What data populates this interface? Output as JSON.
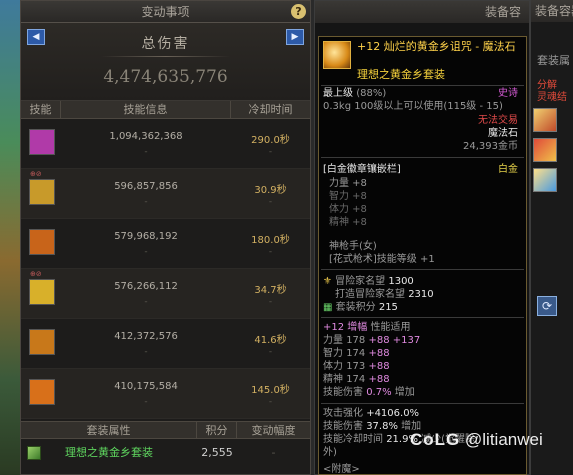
{
  "left_panel": {
    "title": "变动事项",
    "help": "?",
    "total_label": "总伤害",
    "total_value": "4,474,635,776",
    "columns": {
      "skill": "技能",
      "info": "技能信息",
      "cooldown": "冷却时间"
    },
    "skills": [
      {
        "damage": "1,094,362,368",
        "cooldown": "290.0秒",
        "delta": "-",
        "cd_delta": "-",
        "badges": "",
        "icon_color": "#b03aa8"
      },
      {
        "damage": "596,857,856",
        "cooldown": "30.9秒",
        "delta": "-",
        "cd_delta": "-",
        "badges": "⊕⊘",
        "icon_color": "#c89a2a"
      },
      {
        "damage": "579,968,192",
        "cooldown": "180.0秒",
        "delta": "-",
        "cd_delta": "-",
        "badges": "",
        "icon_color": "#c8641a"
      },
      {
        "damage": "576,266,112",
        "cooldown": "34.7秒",
        "delta": "-",
        "cd_delta": "-",
        "badges": "⊕⊘",
        "icon_color": "#d8b02a"
      },
      {
        "damage": "412,372,576",
        "cooldown": "41.6秒",
        "delta": "-",
        "cd_delta": "-",
        "badges": "",
        "icon_color": "#c8781a"
      },
      {
        "damage": "410,175,584",
        "cooldown": "145.0秒",
        "delta": "-",
        "cd_delta": "-",
        "badges": "",
        "icon_color": "#d8701a"
      }
    ],
    "set_columns": {
      "name": "套装属性",
      "score": "积分",
      "change": "变动幅度"
    },
    "set_row": {
      "name": "理想之黄金乡套装",
      "score": "2,555",
      "change": "-"
    }
  },
  "mid_panel": {
    "title": "装备容"
  },
  "tooltip": {
    "name": "+12 灿烂的黄金乡诅咒 - 魔法石",
    "set_name": "理想之黄金乡套装",
    "level_label": "最上级",
    "level_pct": "(88%)",
    "rarity": "史诗",
    "weight": "0.3kg",
    "level_req": "100级以上可以使用(115级 - 15)",
    "untradeable": "无法交易",
    "type": "魔法石",
    "price": "24,393金币",
    "socket_label": "[白金徽章镶嵌栏]",
    "socket_value": "白金",
    "socket_stats": [
      {
        "stat": "力量 +8",
        "active": true
      },
      {
        "stat": "智力 +8",
        "active": false
      },
      {
        "stat": "体力 +8",
        "active": false
      },
      {
        "stat": "精神 +8",
        "active": false
      }
    ],
    "class_name": "神枪手(女)",
    "class_skill": "[花式枪术]技能等级 +1",
    "fame_label": "冒险家名望",
    "fame_value": "1300",
    "forge_fame_label": "打造冒险家名望",
    "forge_fame_value": "2310",
    "set_score_label": "套装积分",
    "set_score_value": "215",
    "amplify_title": "+12 增幅",
    "amplify_sub": "性能适用",
    "amp_stats": [
      {
        "label": "力量",
        "base": "178",
        "plus": "+88",
        "total": "+137"
      },
      {
        "label": "智力",
        "base": "174",
        "plus": "+88",
        "total": ""
      },
      {
        "label": "体力",
        "base": "173",
        "plus": "+88",
        "total": ""
      },
      {
        "label": "精神",
        "base": "174",
        "plus": "+88",
        "total": ""
      }
    ],
    "skill_dmg_label": "技能伤害",
    "skill_dmg_value": "0.7%",
    "skill_dmg_word": "增加",
    "atk_label": "攻击强化",
    "atk_value": "+4106.0%",
    "skill_dmg2_label": "技能伤害",
    "skill_dmg2_value": "37.8%",
    "skill_dmg2_word": "增加",
    "skill_cd_label": "技能冷却时间",
    "skill_cd_value": "21.9%",
    "skill_cd_word": "减少(觉醒除",
    "skill_cd_tail": "外)",
    "footer_label": "<附魔>"
  },
  "right_panel": {
    "title": "装备容器",
    "set_label": "套装属",
    "red_text_1": "分解",
    "red_text_2": "灵魂结"
  },
  "watermark": {
    "brand": "CoLG",
    "handle": "@litianwei"
  }
}
